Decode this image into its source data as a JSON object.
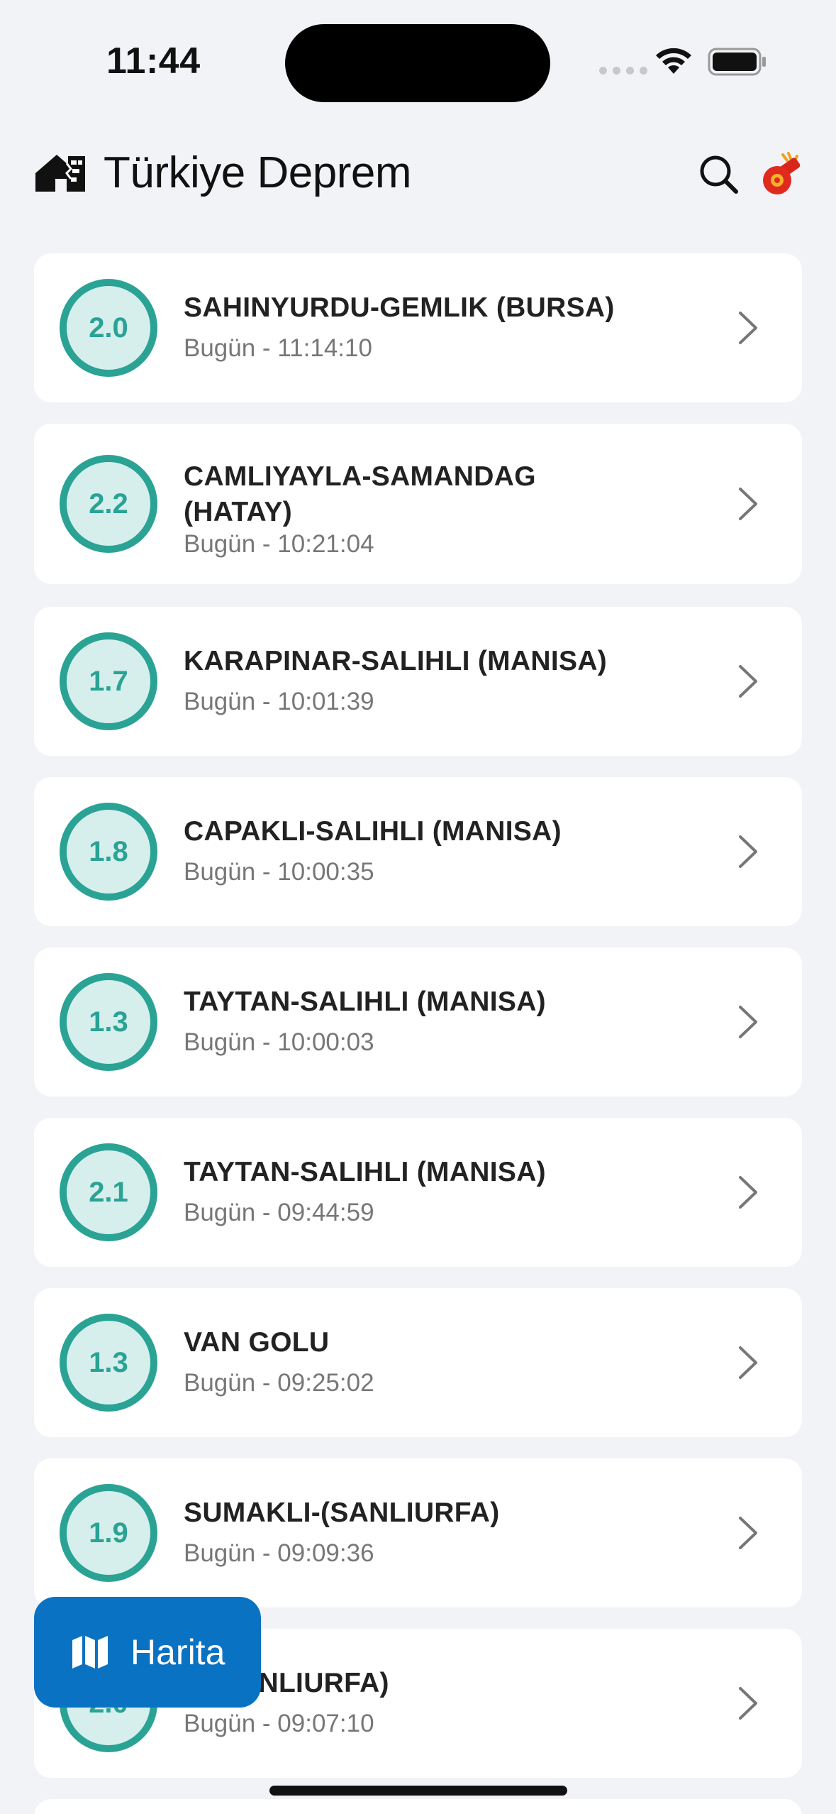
{
  "status_bar": {
    "time": "11:44"
  },
  "header": {
    "title": "Türkiye Deprem"
  },
  "earthquakes": [
    {
      "magnitude": "2.0",
      "location": "SAHINYURDU-GEMLIK (BURSA)",
      "time": "Bugün - 11:14:10"
    },
    {
      "magnitude": "2.2",
      "location": "CAMLIYAYLA-SAMANDAG (HATAY)",
      "time": "Bugün - 10:21:04"
    },
    {
      "magnitude": "1.7",
      "location": "KARAPINAR-SALIHLI (MANISA)",
      "time": "Bugün - 10:01:39"
    },
    {
      "magnitude": "1.8",
      "location": "CAPAKLI-SALIHLI (MANISA)",
      "time": "Bugün - 10:00:35"
    },
    {
      "magnitude": "1.3",
      "location": "TAYTAN-SALIHLI (MANISA)",
      "time": "Bugün - 10:00:03"
    },
    {
      "magnitude": "2.1",
      "location": "TAYTAN-SALIHLI (MANISA)",
      "time": "Bugün - 09:44:59"
    },
    {
      "magnitude": "1.3",
      "location": "VAN GOLU",
      "time": "Bugün - 09:25:02"
    },
    {
      "magnitude": "1.9",
      "location": "SUMAKLI-(SANLIURFA)",
      "time": "Bugün - 09:09:36"
    },
    {
      "magnitude": "2.0",
      "location": "Z-(SANLIURFA)",
      "time": "Bugün - 09:07:10"
    }
  ],
  "map_button": {
    "label": "Harita"
  },
  "colors": {
    "accent": "#2aa395",
    "badge_fill": "#d6efec",
    "map_button": "#0a72c2",
    "background": "#f2f3f7"
  },
  "icons": {
    "logo": "house-crack-icon",
    "search": "search-icon",
    "alert": "whistle-icon",
    "row": "chevron-right-icon",
    "map": "map-icon"
  }
}
